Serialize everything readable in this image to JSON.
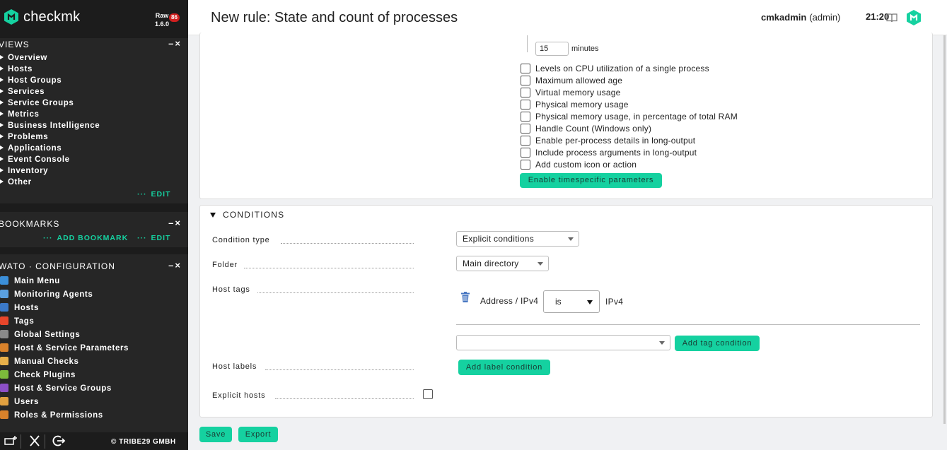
{
  "sidebar": {
    "logo_text": "checkmk",
    "edition_name": "Raw",
    "edition_version": "1.6.0",
    "edition_badge": "86",
    "views": {
      "title": "VIEWS",
      "controls": "–×",
      "items": [
        "Overview",
        "Hosts",
        "Host Groups",
        "Services",
        "Service Groups",
        "Metrics",
        "Business Intelligence",
        "Problems",
        "Applications",
        "Event Console",
        "Inventory",
        "Other"
      ],
      "edit_label": "EDIT"
    },
    "bookmarks": {
      "title": "BOOKMARKS",
      "controls": "–×",
      "add_label": "ADD BOOKMARK",
      "edit_label": "EDIT"
    },
    "wato": {
      "title": "WATO · CONFIGURATION",
      "controls": "–×",
      "items": [
        {
          "label": "Main Menu",
          "icon": "home-icon",
          "color": "#3b8fd9"
        },
        {
          "label": "Monitoring Agents",
          "icon": "agent-icon",
          "color": "#5aa0e0"
        },
        {
          "label": "Hosts",
          "icon": "hosts-icon",
          "color": "#3b79c9"
        },
        {
          "label": "Tags",
          "icon": "tag-icon",
          "color": "#e8462b"
        },
        {
          "label": "Global Settings",
          "icon": "gear-icon",
          "color": "#8a8a8a"
        },
        {
          "label": "Host & Service Parameters",
          "icon": "parameters-icon",
          "color": "#d9822b"
        },
        {
          "label": "Manual Checks",
          "icon": "hand-icon",
          "color": "#e8b04a"
        },
        {
          "label": "Check Plugins",
          "icon": "plugin-icon",
          "color": "#7cba3b"
        },
        {
          "label": "Host & Service Groups",
          "icon": "groups-icon",
          "color": "#8c4fc6"
        },
        {
          "label": "Users",
          "icon": "users-icon",
          "color": "#e0a040"
        },
        {
          "label": "Roles & Permissions",
          "icon": "roles-icon",
          "color": "#d9822b"
        }
      ]
    },
    "footer": {
      "copyright": "© TRIBE29 GMBH"
    }
  },
  "header": {
    "title": "New rule: State and count of processes",
    "user_name": "cmkadmin",
    "user_role": "(admin)",
    "time": "21:20"
  },
  "params": {
    "minutes_value": "15",
    "minutes_label": "minutes",
    "checkboxes": [
      "Levels on CPU utilization of a single process",
      "Maximum allowed age",
      "Virtual memory usage",
      "Physical memory usage",
      "Physical memory usage, in percentage of total RAM",
      "Handle Count (Windows only)",
      "Enable per-process details in long-output",
      "Include process arguments in long-output",
      "Add custom icon or action"
    ],
    "timespecific_button": "Enable timespecific parameters"
  },
  "conditions": {
    "title": "CONDITIONS",
    "condition_type_label": "Condition type",
    "condition_type_value": "Explicit conditions",
    "folder_label": "Folder",
    "folder_value": "Main directory",
    "host_tags_label": "Host tags",
    "tag_name": "Address / IPv4",
    "tag_operator": "is",
    "tag_value": "IPv4",
    "add_tag_button": "Add tag condition",
    "host_labels_label": "Host labels",
    "add_label_button": "Add label condition",
    "explicit_hosts_label": "Explicit hosts"
  },
  "actions": {
    "save": "Save",
    "export": "Export"
  }
}
